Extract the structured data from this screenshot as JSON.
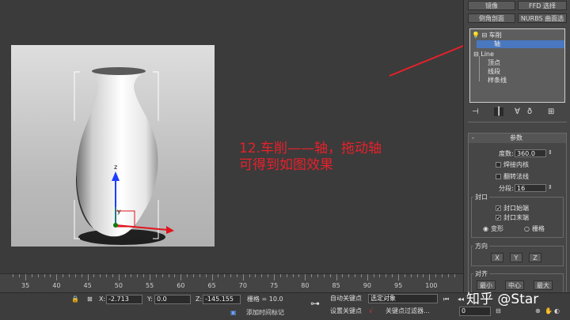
{
  "toolbar": {
    "mirror": "镜像",
    "ffd_select": "FFD 选择",
    "slice_plane": "倒角剖面",
    "nurbs_surface": "NURBS 曲面选择"
  },
  "modifier_stack": {
    "items": [
      {
        "label": "车削",
        "expander": "⊟"
      },
      {
        "label": "轴"
      },
      {
        "label": "Line",
        "expander": "⊟"
      },
      {
        "label": "顶点"
      },
      {
        "label": "线段"
      },
      {
        "label": "样条线"
      }
    ]
  },
  "annotation": {
    "line1": "12.车削——轴，拖动轴",
    "line2": "可得到如图效果"
  },
  "viewport": {
    "gizmo_z": "z",
    "gizmo_y": "y"
  },
  "params": {
    "title": "参数",
    "degrees_label": "度数:",
    "degrees_value": "360.0",
    "weld_core": "焊接内核",
    "flip_normals": "翻转法线",
    "segments_label": "分段:",
    "segments_value": "16",
    "cap_title": "封口",
    "cap_start": "封口始端",
    "cap_end": "封口末端",
    "morph": "变形",
    "grid": "栅格",
    "direction_title": "方向",
    "dir_x": "X",
    "dir_y": "Y",
    "dir_z": "Z",
    "align_title": "对齐",
    "align_min": "最小",
    "align_center": "中心",
    "align_max": "最大"
  },
  "timeline": {
    "ticks": [
      "35",
      "40",
      "45",
      "50",
      "55",
      "60",
      "65",
      "70",
      "75",
      "80",
      "85",
      "90",
      "95",
      "100"
    ]
  },
  "status": {
    "x_label": "X:",
    "x_value": "-2.713",
    "y_label": "Y:",
    "y_value": "0.0",
    "z_label": "Z:",
    "z_value": "-145.155",
    "grid_text": "栅格 = 10.0",
    "auto_key": "自动关键点",
    "selected_object": "选定对象",
    "set_key": "设置关键点",
    "key_filters": "关键点过滤器...",
    "add_time_tag": "添加时间标记",
    "frame_value": "0"
  },
  "watermark": "知乎 @Star"
}
